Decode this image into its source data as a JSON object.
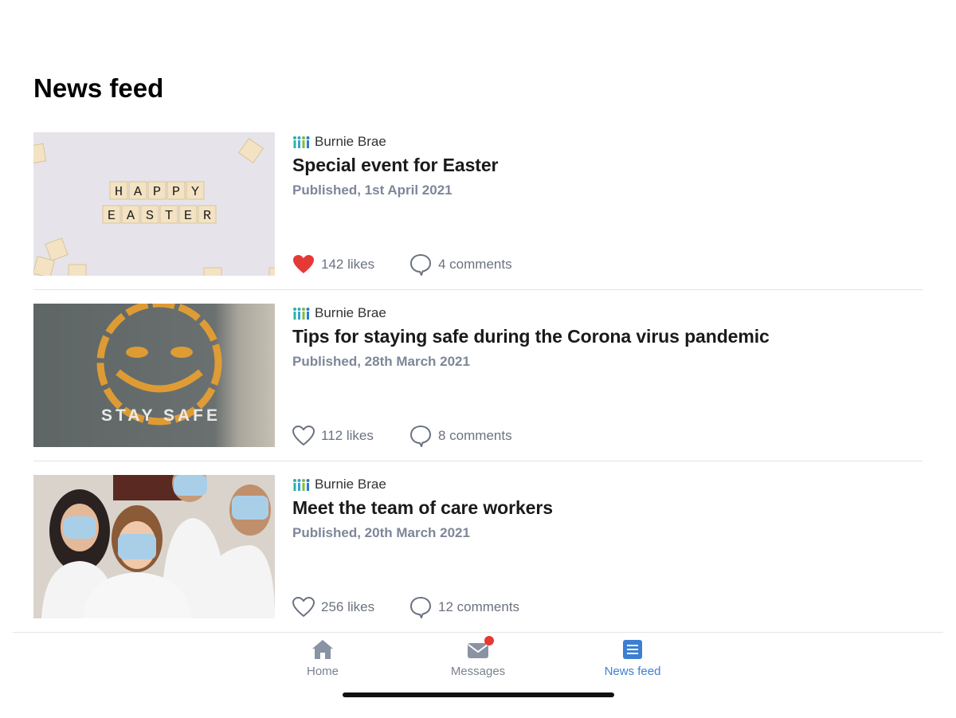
{
  "header": {
    "title": "News feed"
  },
  "posts": [
    {
      "org": "Burnie Brae",
      "title": "Special event for Easter",
      "published": "Published, 1st April 2021",
      "likes": "142 likes",
      "comments": "4 comments",
      "liked": true,
      "image_caption": [
        "HAPPY",
        "EASTER"
      ]
    },
    {
      "org": "Burnie Brae",
      "title": "Tips for staying safe during the Corona virus pandemic",
      "published": "Published, 28th March 2021",
      "likes": "112 likes",
      "comments": "8 comments",
      "liked": false,
      "image_caption": [
        "STAY SAFE"
      ]
    },
    {
      "org": "Burnie Brae",
      "title": "Meet the team of care workers",
      "published": "Published, 20th March 2021",
      "likes": "256 likes",
      "comments": "12 comments",
      "liked": false
    }
  ],
  "tabbar": {
    "items": [
      {
        "label": "Home",
        "icon": "home-icon",
        "active": false
      },
      {
        "label": "Messages",
        "icon": "mail-icon",
        "active": false,
        "badge": true
      },
      {
        "label": "News feed",
        "icon": "newsfeed-icon",
        "active": true
      }
    ]
  },
  "colors": {
    "accent": "#3b7fd2",
    "like": "#e53935",
    "muted": "#7d8798",
    "badge": "#e53935"
  }
}
